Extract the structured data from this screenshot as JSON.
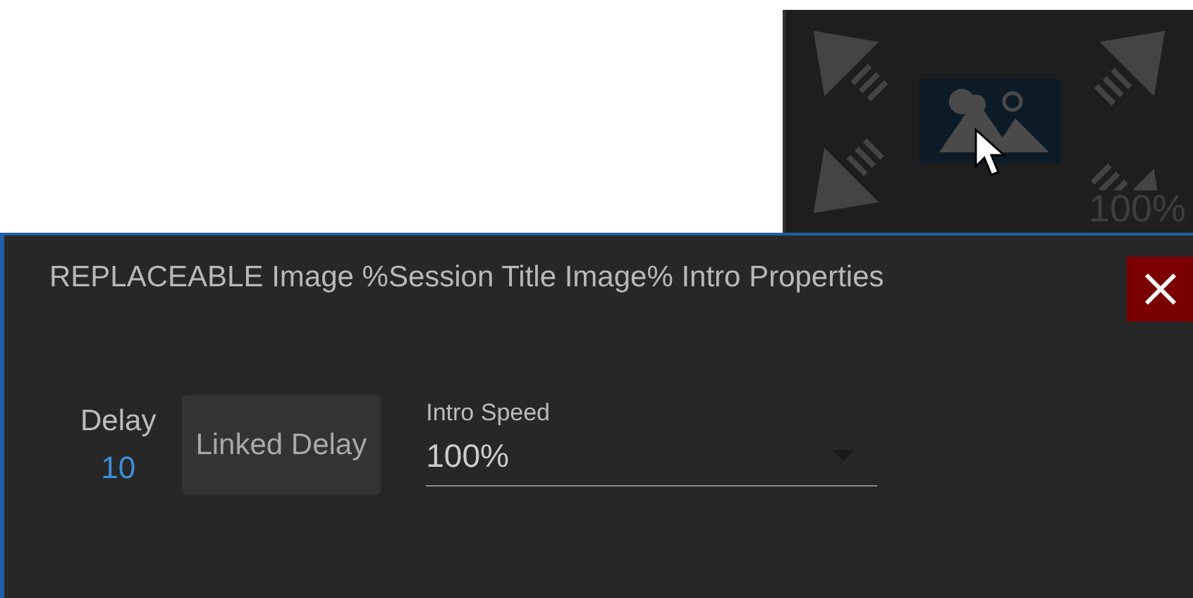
{
  "position_picker": {
    "positions": [
      {
        "kind": "arrow",
        "selected": false
      },
      {
        "kind": "image",
        "selected": true
      },
      {
        "kind": "arrow",
        "selected": false
      },
      {
        "kind": "arrow",
        "selected": false
      },
      {
        "kind": "arrow",
        "selected": false
      }
    ],
    "zoom": "100%"
  },
  "dialog": {
    "title": "REPLACEABLE Image %Session Title Image% Intro Properties",
    "delay": {
      "label": "Delay",
      "value": "10"
    },
    "linked_delay_button": "Linked Delay",
    "intro_speed": {
      "label": "Intro Speed",
      "value": "100%"
    }
  }
}
